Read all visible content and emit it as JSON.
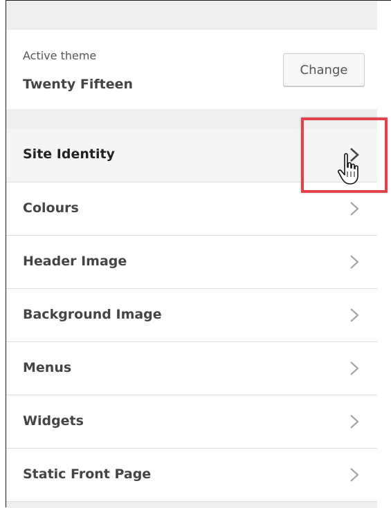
{
  "theme": {
    "label": "Active theme",
    "name": "Twenty Fifteen",
    "change_label": "Change"
  },
  "menu": {
    "items": [
      {
        "label": "Site Identity",
        "icon": "chevron-right-icon"
      },
      {
        "label": "Colours",
        "icon": "chevron-right-icon"
      },
      {
        "label": "Header Image",
        "icon": "chevron-right-icon"
      },
      {
        "label": "Background Image",
        "icon": "chevron-right-icon"
      },
      {
        "label": "Menus",
        "icon": "chevron-right-icon"
      },
      {
        "label": "Widgets",
        "icon": "chevron-right-icon"
      },
      {
        "label": "Static Front Page",
        "icon": "chevron-right-icon"
      }
    ]
  },
  "overlay": {
    "highlight_color": "#e0414a",
    "cursor_icon": "hand-pointer-icon"
  }
}
